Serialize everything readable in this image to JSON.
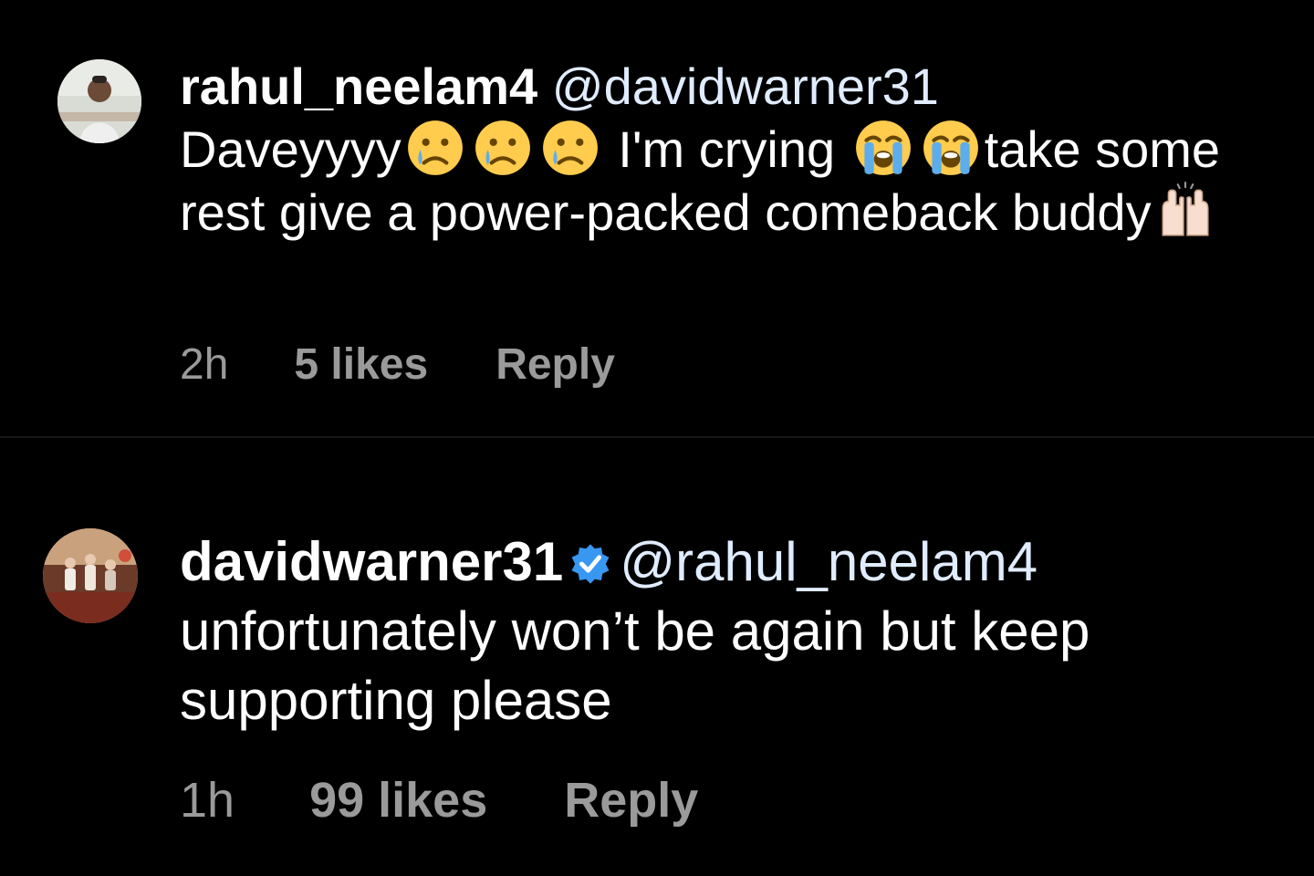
{
  "comments": [
    {
      "username": "rahul_neelam4",
      "verified": false,
      "mention": "@davidwarner31",
      "text_part1": "Daveyyyy",
      "emoji_a": "crying-face-icon",
      "text_part2": " I'm crying ",
      "emoji_b": "loudly-crying-face-icon",
      "text_part3": "take some rest give a power-packed comeback buddy",
      "emoji_c": "raising-hands-icon",
      "time": "2h",
      "likes": "5 likes",
      "reply_label": "Reply"
    },
    {
      "username": "davidwarner31",
      "verified": true,
      "mention": "@rahul_neelam4",
      "text": "unfortunately won’t be again but keep supporting please",
      "time": "1h",
      "likes": "99 likes",
      "reply_label": "Reply"
    }
  ],
  "colors": {
    "background": "#000000",
    "text": "#ffffff",
    "meta": "#9a9a9a",
    "verified_badge": "#3897f0"
  }
}
